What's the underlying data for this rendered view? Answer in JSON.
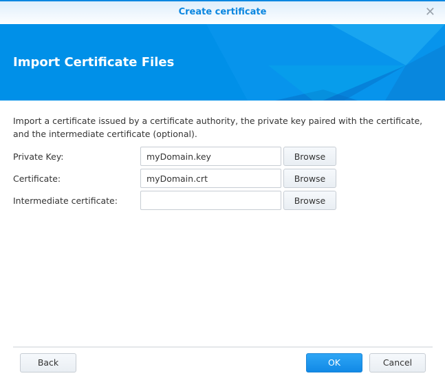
{
  "window": {
    "title": "Create certificate",
    "close_icon": "close-icon"
  },
  "banner": {
    "title": "Import Certificate Files"
  },
  "description": "Import a certificate issued by a certificate authority, the private key paired with the certificate, and the intermediate certificate (optional).",
  "fields": [
    {
      "label": "Private Key:",
      "value": "myDomain.key",
      "button": "Browse"
    },
    {
      "label": "Certificate:",
      "value": "myDomain.crt",
      "button": "Browse"
    },
    {
      "label": "Intermediate certificate:",
      "value": "",
      "button": "Browse"
    }
  ],
  "footer": {
    "back": "Back",
    "ok": "OK",
    "cancel": "Cancel"
  }
}
